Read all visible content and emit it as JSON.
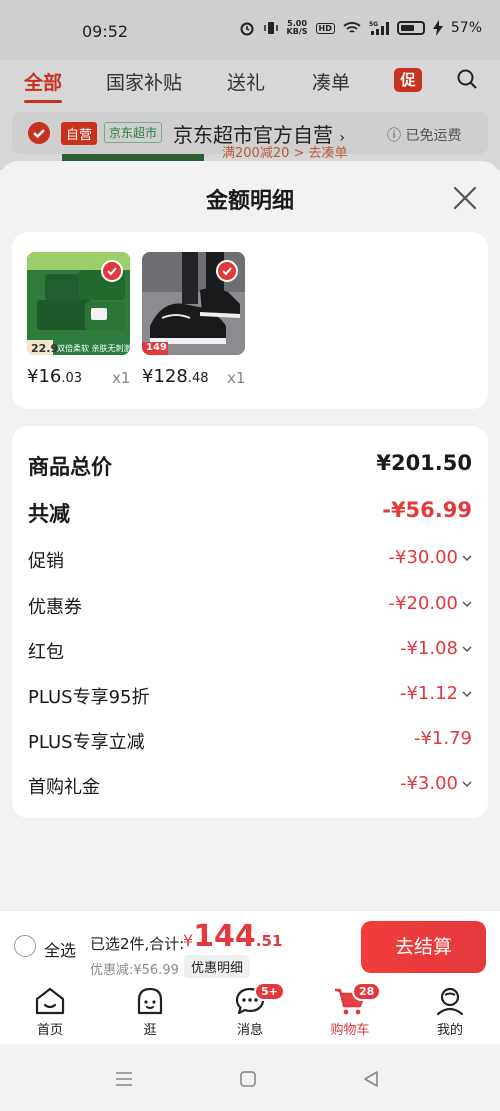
{
  "status_bar": {
    "time": "09:52",
    "net_speed_value": "5.00",
    "net_speed_unit": "KB/S",
    "hd": "HD",
    "signal": "5G",
    "battery": "57%"
  },
  "background": {
    "tabs": [
      "全部",
      "国家补贴",
      "送礼",
      "凑单"
    ],
    "promo_badge": "促",
    "store": {
      "self_operated": "自营",
      "supermarket_tag": "京东超市",
      "name": "京东超市官方自营",
      "free_shipping": "已免运费"
    },
    "promo_text": "满200减20 > 去凑单"
  },
  "modal": {
    "title": "金额明细",
    "products": [
      {
        "image": "tissue-pack",
        "thumb_price": "22.9",
        "thumb_slogan": "双倍柔软 亲肤无刺激",
        "price_int": "¥16",
        "price_dec": ".03",
        "qty": "x1"
      },
      {
        "image": "sneaker",
        "thumb_price": "149",
        "price_int": "¥128",
        "price_dec": ".48",
        "qty": "x1"
      }
    ],
    "rows": [
      {
        "label": "商品总价",
        "value": "¥201.50"
      },
      {
        "label": "共减",
        "value": "-¥56.99"
      },
      {
        "label": "促销",
        "value": "-¥30.00"
      },
      {
        "label": "优惠券",
        "value": "-¥20.00"
      },
      {
        "label": "红包",
        "value": "-¥1.08"
      },
      {
        "label": "PLUS专享95折",
        "value": "-¥1.12"
      },
      {
        "label": "PLUS专享立减",
        "value": "-¥1.79"
      },
      {
        "label": "首购礼金",
        "value": "-¥3.00"
      }
    ]
  },
  "checkout": {
    "select_all": "全选",
    "summary": "已选2件,合计:",
    "currency": "¥",
    "total_int": "144",
    "total_dec": ".51",
    "saved": "优惠减:¥56.99",
    "detail_button": "优惠明细",
    "checkout_button": "去结算"
  },
  "tabs": [
    {
      "label": "首页",
      "icon": "home-icon"
    },
    {
      "label": "逛",
      "icon": "browse-icon"
    },
    {
      "label": "消息",
      "icon": "message-icon",
      "badge": "5+"
    },
    {
      "label": "购物车",
      "icon": "cart-icon",
      "badge": "28"
    },
    {
      "label": "我的",
      "icon": "profile-icon"
    }
  ],
  "colors": {
    "accent": "#e4393c",
    "green": "#2e7d42"
  }
}
